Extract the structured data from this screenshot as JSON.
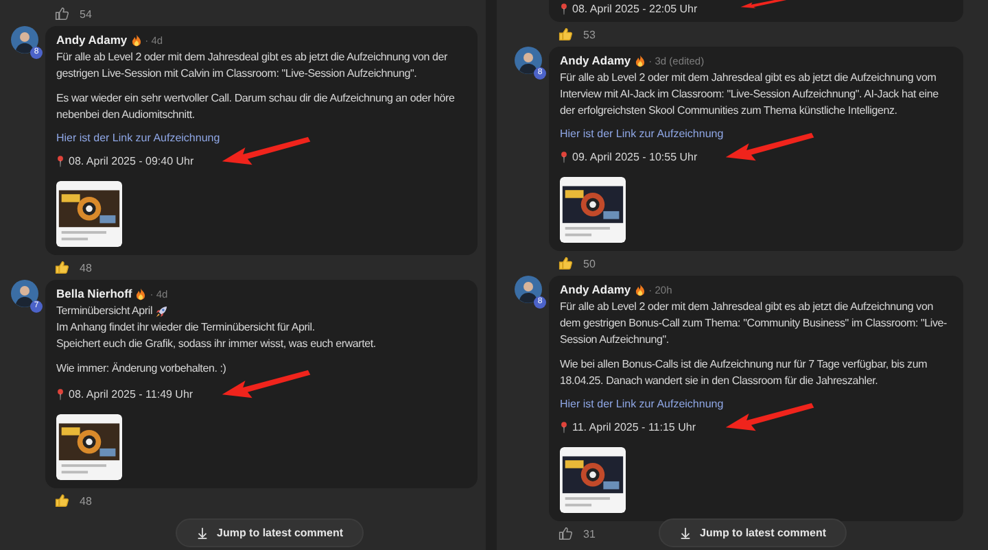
{
  "columns": [
    {
      "entries": [
        {
          "kind": "likes",
          "count": "54",
          "liked": false
        },
        {
          "kind": "comment",
          "author": "Andy Adamy",
          "badge": "8",
          "time": "· 4d",
          "blocks": [
            [
              {
                "text": "Für alle ab Level 2 oder mit dem Jahresdeal gibt es ab jetzt die Aufzeichnung von der gestrigen Live-Session mit Calvin im Classroom: \"Live-Session Aufzeichnung\"."
              }
            ],
            [
              {
                "text": "Es war wieder ein sehr wertvoller Call. Darum schau dir die Aufzeichnung an oder höre nebenbei den Audiomitschnitt."
              }
            ]
          ],
          "link": "Hier ist der Link zur Aufzeichnung",
          "date": "08. April 2025 - 09:40 Uhr",
          "arrow": true,
          "image": {
            "kind": "picture"
          }
        },
        {
          "kind": "likes",
          "count": "48",
          "liked": true
        },
        {
          "kind": "comment",
          "author": "Bella Nierhoff",
          "badge": "7",
          "time": "· 4d",
          "blocks": [
            [
              {
                "text": "Terminübersicht April",
                "kind": "rocket"
              },
              {
                "text": "Im Anhang findet ihr wieder die Terminübersicht für April."
              },
              {
                "text": "Speichert euch die Grafik, sodass ihr immer wisst, was euch erwartet."
              }
            ],
            [
              {
                "text": "Wie immer: Änderung vorbehalten. :)"
              }
            ]
          ],
          "date": "08. April 2025 - 11:49 Uhr",
          "arrow": true,
          "image": {
            "kind": "picture"
          }
        },
        {
          "kind": "likes",
          "count": "48",
          "liked": true
        }
      ],
      "jump": "Jump to latest comment"
    },
    {
      "entries": [
        {
          "kind": "tail",
          "date": "08. April 2025 - 22:05 Uhr",
          "arrow": true
        },
        {
          "kind": "likes",
          "count": "53",
          "liked": true
        },
        {
          "kind": "comment",
          "author": "Andy Adamy",
          "badge": "8",
          "time": "· 3d (edited)",
          "blocks": [
            [
              {
                "text": "Für alle ab Level 2 oder mit dem Jahresdeal gibt es ab jetzt die Aufzeichnung vom Interview mit AI-Jack im Classroom: \"Live-Session Aufzeichnung\". AI-Jack hat eine der erfolgreichsten Skool Communities zum Thema künstliche Intelligenz."
              }
            ]
          ],
          "link": "Hier ist der Link zur Aufzeichnung",
          "date": "09. April 2025 - 10:55 Uhr",
          "arrow": true,
          "image": {
            "kind": "picture"
          }
        },
        {
          "kind": "likes",
          "count": "50",
          "liked": true
        },
        {
          "kind": "comment",
          "author": "Andy Adamy",
          "badge": "8",
          "time": "· 20h",
          "blocks": [
            [
              {
                "text": "Für alle ab Level 2 oder mit dem Jahresdeal gibt es ab jetzt die Aufzeichnung von dem gestrigen Bonus-Call zum Thema: \"Community Business\" im Classroom: \"Live-Session Aufzeichnung\"."
              }
            ],
            [
              {
                "text": "Wie bei allen Bonus-Calls ist die Aufzeichnung nur für 7 Tage verfügbar, bis zum 18.04.25. Danach wandert sie in den Classroom für die Jahreszahler."
              }
            ]
          ],
          "link": "Hier ist der Link zur Aufzeichnung",
          "date": "11. April 2025 - 11:15 Uhr",
          "arrow": true,
          "image": {
            "kind": "picture"
          }
        },
        {
          "kind": "likes",
          "count": "31",
          "liked": false
        }
      ],
      "jump": "Jump to latest comment"
    }
  ]
}
